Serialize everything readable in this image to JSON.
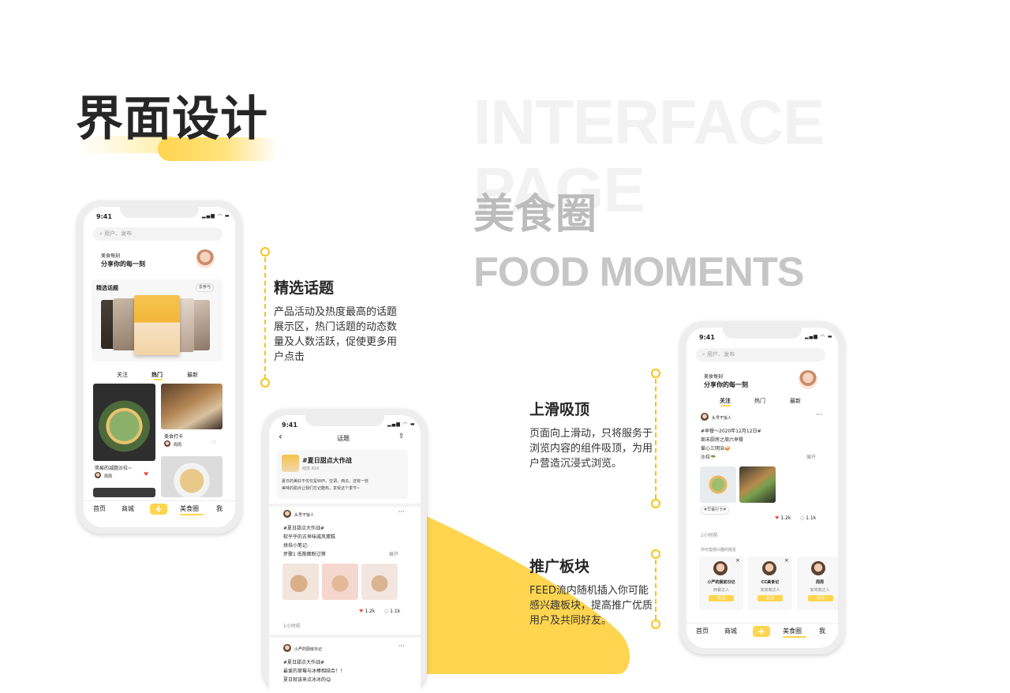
{
  "header": {
    "title_cn": "界面设计",
    "title_en": "INTERFACE PAGE",
    "section_cn": "美食圈",
    "section_en": "FOOD MOMENTS"
  },
  "colors": {
    "accent": "#ffd54f",
    "like": "#e8564a",
    "title": "#262626",
    "muted": "#bcbcbc"
  },
  "annotations": {
    "topics": {
      "title": "精选话题",
      "text": [
        "产品活动及热度最高的话题",
        "展示区，热门话题的动态数",
        "量及人数活跃，促使更多用",
        "户点击"
      ]
    },
    "sticky": {
      "title": "上滑吸顶",
      "text": [
        "页面向上滑动，只将服务于",
        "浏览内容的组件吸顶，为用",
        "户营造沉浸式浏览。"
      ]
    },
    "promo": {
      "title": "推广板块",
      "text": [
        "FEED流内随机插入你可能",
        "感兴趣板块，提高推广优质",
        "用户及共同好友。"
      ]
    }
  },
  "phone1": {
    "time": "9:41",
    "search_placeholder": "用户、发布",
    "brand_small": "美食每刻",
    "brand_slogan": "分享你的每一刻",
    "topics_label": "精选话题",
    "topics_more": "去参与",
    "tabs": [
      "关注",
      "热门",
      "最新"
    ],
    "active_tab": "热门",
    "cards": [
      {
        "title": "简易的减脂沙拉~",
        "user": "周周"
      },
      {
        "title": "美食打卡",
        "user": "周周"
      }
    ],
    "nav": [
      "首页",
      "商城",
      "+",
      "美食圈",
      "我"
    ]
  },
  "phone2": {
    "time": "9:41",
    "header_title": "话题",
    "topic_name": "#夏日甜点大作战",
    "topic_count": "动态 816",
    "topic_desc": [
      "夏日的美好不仅仅是WiFi、空调、西瓜，还有一些",
      "美味的甜点让我们忘记酷热，享受这个季节~"
    ],
    "post1": {
      "user": "头号干饭人",
      "lines": [
        "#夏日甜点大作战#",
        "软乎乎的古早味戚风蛋糕",
        "烘培小笔记:",
        "步骤1 低筋面粉过筛"
      ],
      "expand": "展开",
      "likes": "1.2k",
      "comments": "1.1k",
      "time": "1小时前"
    },
    "post2": {
      "user": "小严的厨房日记",
      "lines": [
        "#夏日甜点大作战#",
        "最爱的草莓与冰棒相结合！！",
        "夏日就该来点冰冰的😋"
      ]
    }
  },
  "phone3": {
    "time": "9:41",
    "search_placeholder": "用户、发布",
    "brand_small": "美食每刻",
    "brand_slogan": "分享你的每一刻",
    "tabs": [
      "关注",
      "热门",
      "最新"
    ],
    "post": {
      "user": "头号干饭人",
      "lines": [
        "#早餐～2020年12月12日#",
        "周末厨房之周六早餐",
        "爱心三明治🥪",
        "沙拉🥗"
      ],
      "expand": "展开",
      "tag": "#早餐打卡#",
      "likes": "1.2k",
      "comments": "1.1k",
      "time": "1小时前"
    },
    "recommend_label": "你可能感兴趣的朋友",
    "friends": [
      {
        "name": "小严的厨房日记",
        "role": "西餐达人",
        "action": "关注"
      },
      {
        "name": "CC美食记",
        "role": "家常菜达人",
        "action": "关注"
      },
      {
        "name": "周周",
        "role": "家常菜达人",
        "action": "关注"
      }
    ],
    "nav": [
      "首页",
      "商城",
      "+",
      "美食圈",
      "我"
    ]
  }
}
